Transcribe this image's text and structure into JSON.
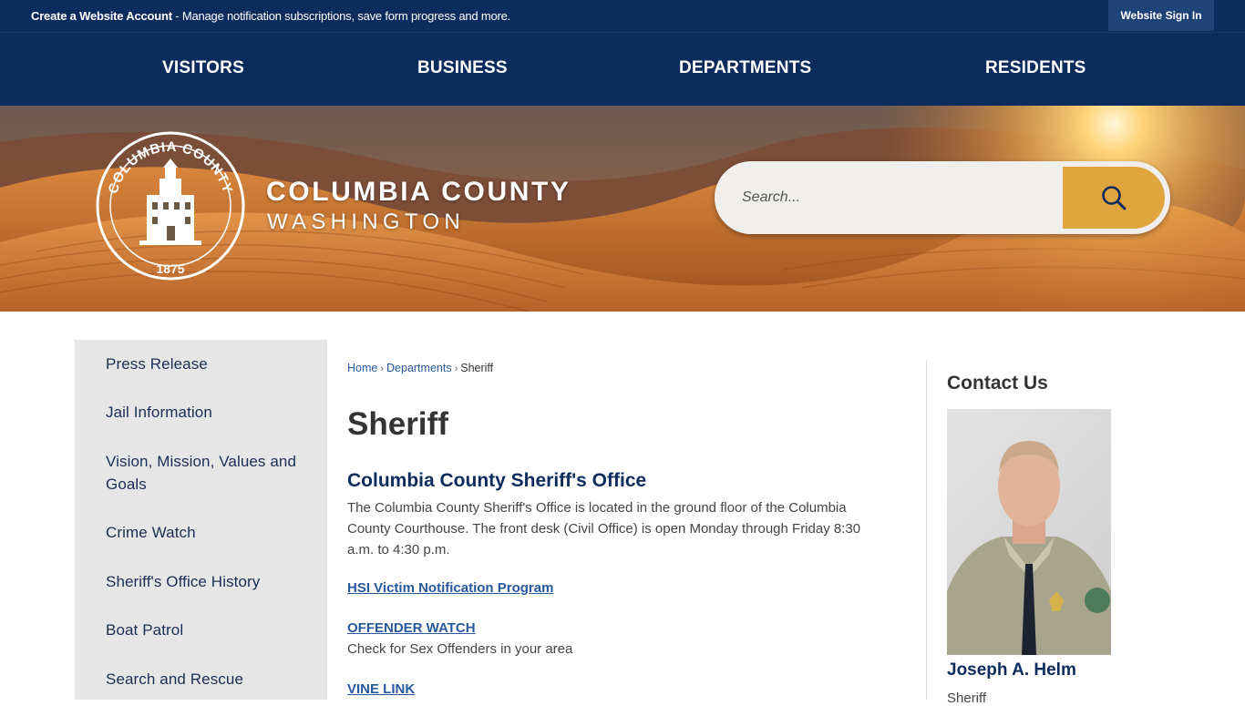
{
  "topbar": {
    "create_account": "Create a Website Account",
    "account_desc": "- Manage notification subscriptions, save form progress and more.",
    "sign_in": "Website Sign In"
  },
  "nav": {
    "items": [
      {
        "label": "VISITORS"
      },
      {
        "label": "BUSINESS"
      },
      {
        "label": "DEPARTMENTS"
      },
      {
        "label": "RESIDENTS"
      }
    ]
  },
  "brand": {
    "line1": "COLUMBIA COUNTY",
    "line2": "WASHINGTON",
    "seal_text": "COLUMBIA COUNTY",
    "seal_year": "1875"
  },
  "search": {
    "placeholder": "Search..."
  },
  "sidebar": {
    "items": [
      {
        "label": "Press Release"
      },
      {
        "label": "Jail Information"
      },
      {
        "label": "Vision, Mission, Values and Goals"
      },
      {
        "label": "Crime Watch"
      },
      {
        "label": "Sheriff's Office History"
      },
      {
        "label": "Boat Patrol"
      },
      {
        "label": "Search and Rescue"
      }
    ]
  },
  "breadcrumb": {
    "home": "Home",
    "departments": "Departments",
    "current": "Sheriff",
    "sep": "›"
  },
  "main": {
    "title": "Sheriff",
    "section_heading": "Columbia County Sheriff's Office",
    "intro": "The Columbia County Sheriff's Office is located in the ground floor of the Columbia County Courthouse. The front desk (Civil Office) is open Monday through Friday 8:30 a.m. to 4:30 p.m.",
    "link_hsi": "HSI Victim Notification Program",
    "link_offender": "OFFENDER WATCH",
    "offender_desc": "Check for Sex Offenders in your area",
    "link_vine": "VINE LINK"
  },
  "contact": {
    "title": "Contact Us",
    "name": "Joseph A. Helm",
    "role": "Sheriff"
  },
  "colors": {
    "navy": "#0c2c5e",
    "search_button": "#e0a53f",
    "link": "#28589c",
    "sidebar_bg": "#e6e6e6"
  },
  "icons": {
    "search_button": "search-icon"
  }
}
